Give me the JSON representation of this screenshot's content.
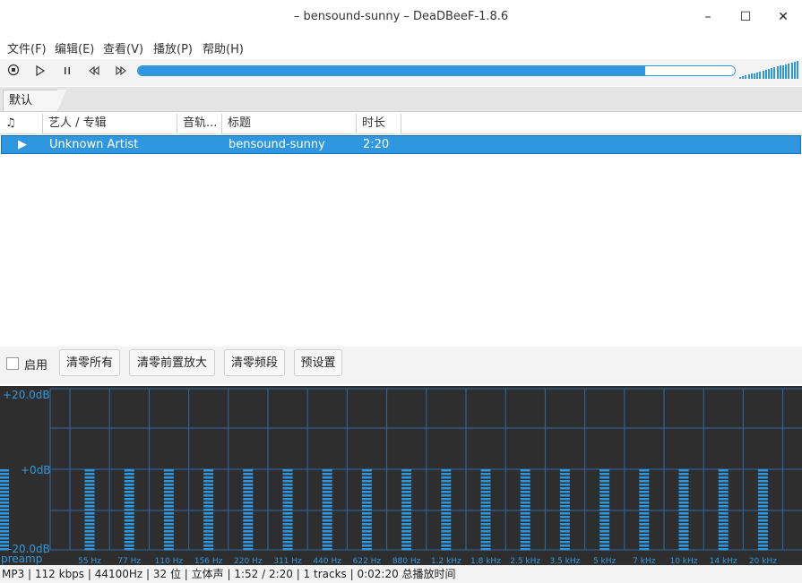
{
  "window": {
    "title": "– bensound-sunny – DeaDBeeF-1.8.6"
  },
  "window_controls": {
    "minimize": "–",
    "maximize": "☐",
    "close": "✕"
  },
  "menu": [
    "文件(F)",
    "编辑(E)",
    "查看(V)",
    "播放(P)",
    "帮助(H)"
  ],
  "toolbar": {
    "buttons": [
      "stop-icon",
      "play-icon",
      "pause-icon",
      "prev-icon",
      "next-icon"
    ],
    "seek_fraction": 0.85,
    "volume_fraction": 1.0
  },
  "tabs": [
    "默认"
  ],
  "playlist": {
    "columns": [
      "♫",
      "艺人 / 专辑",
      "音轨...",
      "标题",
      "时长"
    ],
    "rows": [
      {
        "playing": "▶",
        "artist": "Unknown Artist",
        "track": "",
        "title": "bensound-sunny",
        "duration": "2:20"
      }
    ]
  },
  "eq_toolbar": {
    "enable_label": "启用",
    "buttons": [
      "清零所有",
      "清零前置放大",
      "清零频段",
      "预设置"
    ]
  },
  "equalizer": {
    "db_labels": [
      "+20.0dB",
      "+0dB",
      "-20.0dB"
    ],
    "preamp_label": "preamp",
    "bands": [
      "55 Hz",
      "77 Hz",
      "110 Hz",
      "156 Hz",
      "220 Hz",
      "311 Hz",
      "440 Hz",
      "622 Hz",
      "880 Hz",
      "1.2 kHz",
      "1.8 kHz",
      "2.5 kHz",
      "3.5 kHz",
      "5 kHz",
      "7 kHz",
      "10 kHz",
      "14 kHz",
      "20 kHz"
    ],
    "values_db": [
      0,
      0,
      0,
      0,
      0,
      0,
      0,
      0,
      0,
      0,
      0,
      0,
      0,
      0,
      0,
      0,
      0,
      0
    ],
    "preamp_db": 0,
    "colors": {
      "bars": "#2f97e0",
      "grid": "#2f6aa8",
      "labels": "#3399dd"
    }
  },
  "status": "MP3 | 112 kbps | 44100Hz | 32 位 | 立体声 | 1:52 / 2:20 | 1 tracks | 0:02:20 总播放时间"
}
